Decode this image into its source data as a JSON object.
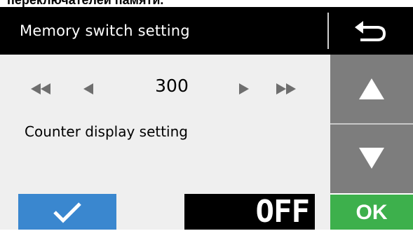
{
  "caption": "переключателей памяти.",
  "header": {
    "title": "Memory switch setting",
    "back_icon": "return-arrow-icon"
  },
  "setting": {
    "value": "300",
    "description": "Counter display setting",
    "state": "OFF"
  },
  "nav_icons": [
    "fast-rewind-icon",
    "step-back-icon",
    "step-forward-icon",
    "fast-forward-icon"
  ],
  "side": {
    "up_icon": "up-triangle-icon",
    "down_icon": "down-triangle-icon",
    "ok_label": "OK"
  },
  "confirm_icon": "checkmark-icon",
  "colors": {
    "header_bg": "#000000",
    "content_bg": "#efefef",
    "side_gray": "#7d7d7d",
    "ok_green": "#3db04c",
    "check_blue": "#3a87cf",
    "nav_gray": "#6e6e6e"
  }
}
